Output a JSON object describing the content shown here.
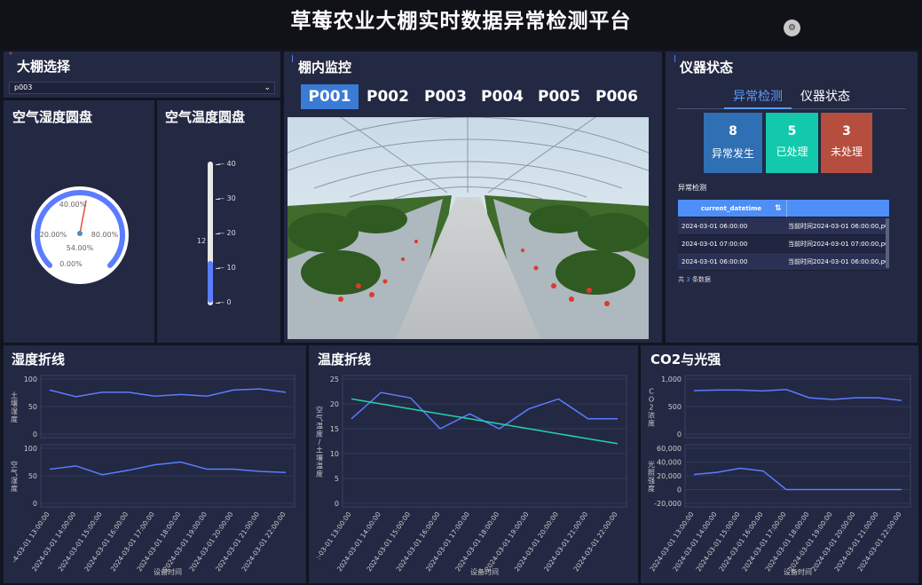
{
  "header": {
    "title": "草莓农业大棚实时数据异常检测平台",
    "button_icon": "settings-icon"
  },
  "greenhouse_select": {
    "title": "大棚选择",
    "value": "p003"
  },
  "humidity_gauge": {
    "title": "空气湿度圆盘",
    "value_label": "54.00%",
    "value": 54,
    "labels": [
      "40.00%",
      "20.00%",
      "80.00%",
      "0.00%"
    ]
  },
  "temp_thermo": {
    "title": "空气温度圆盘",
    "current": "12",
    "value": 12,
    "ticks": [
      "40",
      "30",
      "20",
      "10",
      "0"
    ]
  },
  "monitor": {
    "title": "棚内监控",
    "tabs": [
      "P001",
      "P002",
      "P003",
      "P004",
      "P005",
      "P006"
    ],
    "active_tab": "P001"
  },
  "instrument": {
    "title": "仪器状态",
    "tabs": [
      "异常检测",
      "仪器状态"
    ],
    "stats": [
      {
        "num": "8",
        "label": "异常发生",
        "color": "#2f6fb3"
      },
      {
        "num": "5",
        "label": "已处理",
        "color": "#12c9ac"
      },
      {
        "num": "3",
        "label": "未处理",
        "color": "#b54e3e"
      }
    ],
    "table_title": "异常检测",
    "table_header": "current_datetime",
    "rows": [
      {
        "c1": "2024-03-01 06:00:00",
        "c2": "当前时间2024-03-01 06:00:00,pC"
      },
      {
        "c1": "2024-03-01 07:00:00",
        "c2": "当前时间2024-03-01 07:00:00,pC"
      },
      {
        "c1": "2024-03-01 06:00:00",
        "c2": "当前时间2024-03-01 06:00:00,pC"
      }
    ],
    "footer_prefix": "共",
    "footer_count": "3",
    "footer_suffix": "条数据"
  },
  "chart_data": [
    {
      "type": "line",
      "title": "湿度折线",
      "xlabel": "设备时间",
      "categories": [
        "2024-03-01 13:00:00",
        "2024-03-01 14:00:00",
        "2024-03-01 15:00:00",
        "2024-03-01 16:00:00",
        "2024-03-01 17:00:00",
        "2024-03-01 18:00:00",
        "2024-03-01 19:00:00",
        "2024-03-01 20:00:00",
        "2024-03-01 21:00:00",
        "2024-03-01 22:00:00"
      ],
      "category_labels": [
        "-4-03-01 13:00:00",
        "2024-03-01 14:00:00",
        "2024-03-01 15:00:00",
        "2024-03-01 16:00:00",
        "2024-03-01 17:00:00",
        "2024-03-01 18:00:00",
        "2024-03-01 19:00:00",
        "2024-03-01 20:00:00",
        "2024-03-01 21:00:00",
        "2024-03-01 22:00:00"
      ],
      "panels": [
        {
          "ylabel": "土壤湿度",
          "ylim": [
            0,
            100
          ],
          "yticks": [
            "100",
            "50",
            "0"
          ],
          "values": [
            80,
            68,
            76,
            76,
            69,
            72,
            69,
            80,
            82,
            76
          ]
        },
        {
          "ylabel": "空气湿度",
          "ylim": [
            0,
            100
          ],
          "yticks": [
            "100",
            "50",
            "0"
          ],
          "values": [
            62,
            68,
            52,
            60,
            70,
            75,
            62,
            62,
            58,
            56
          ]
        }
      ]
    },
    {
      "type": "line",
      "title": "温度折线",
      "xlabel": "设备时间",
      "ylabel": "空气温度/土壤温度",
      "ylim": [
        0,
        25
      ],
      "yticks": [
        "25",
        "20",
        "15",
        "10",
        "5",
        "0"
      ],
      "categories": [
        "2024-03-01 13:00:00",
        "2024-03-01 14:00:00",
        "2024-03-01 15:00:00",
        "2024-03-01 16:00:00",
        "2024-03-01 17:00:00",
        "2024-03-01 18:00:00",
        "2024-03-01 19:00:00",
        "2024-03-01 20:00:00",
        "2024-03-01 21:00:00",
        "2024-03-01 22:00:00"
      ],
      "category_labels": [
        ":-03-01 13:00:00",
        "2024-03-01 14:00:00",
        "2024-03-01 15:00:00",
        "2024-03-01 16:00:00",
        "2024-03-01 17:00:00",
        "2024-03-01 18:00:00",
        "2024-03-01 19:00:00",
        "2024-03-01 20:00:00",
        "2024-03-01 21:00:00",
        "2024-03-01 22:00:00"
      ],
      "series": [
        {
          "color": "#5b7cff",
          "values": [
            17,
            22.3,
            21.2,
            15,
            18,
            15,
            19,
            21,
            17,
            17
          ]
        },
        {
          "color": "#22d3a8",
          "values": [
            21,
            20,
            19,
            18,
            17,
            16,
            15,
            14,
            13,
            12
          ]
        }
      ]
    },
    {
      "type": "line",
      "title": "CO2与光强",
      "xlabel": "设备时间",
      "categories": [
        "2024-03-01 13:00:00",
        "2024-03-01 14:00:00",
        "2024-03-01 15:00:00",
        "2024-03-01 16:00:00",
        "2024-03-01 17:00:00",
        "2024-03-01 18:00:00",
        "2024-03-01 19:00:00",
        "2024-03-01 20:00:00",
        "2024-03-01 21:00:00",
        "2024-03-01 22:00:00"
      ],
      "category_labels": [
        "2024-03-01 13:00:00",
        "2024-03-01 14:00:00",
        "2024-03-01 15:00:00",
        "2024-03-01 16:00:00",
        "2024-03-01 17:00:00",
        "2024-03-01 18:00:00",
        "2024-03-01 19:00:00",
        "2024-03-01 20:00:00",
        "2024-03-01 21:00:00",
        "2024-03-01 22:00:00"
      ],
      "panels": [
        {
          "ylabel": "CO2浓度",
          "ylim": [
            0,
            1000
          ],
          "yticks": [
            "1,000",
            "500",
            "0"
          ],
          "values": [
            790,
            800,
            800,
            785,
            810,
            660,
            630,
            660,
            660,
            610
          ]
        },
        {
          "ylabel": "光照强度",
          "ylim": [
            -20000,
            60000
          ],
          "yticks": [
            "60,000",
            "40,000",
            "20,000",
            "0",
            "-20,000"
          ],
          "values": [
            22000,
            25000,
            31000,
            27000,
            0,
            0,
            0,
            0,
            0,
            0
          ]
        }
      ]
    }
  ]
}
